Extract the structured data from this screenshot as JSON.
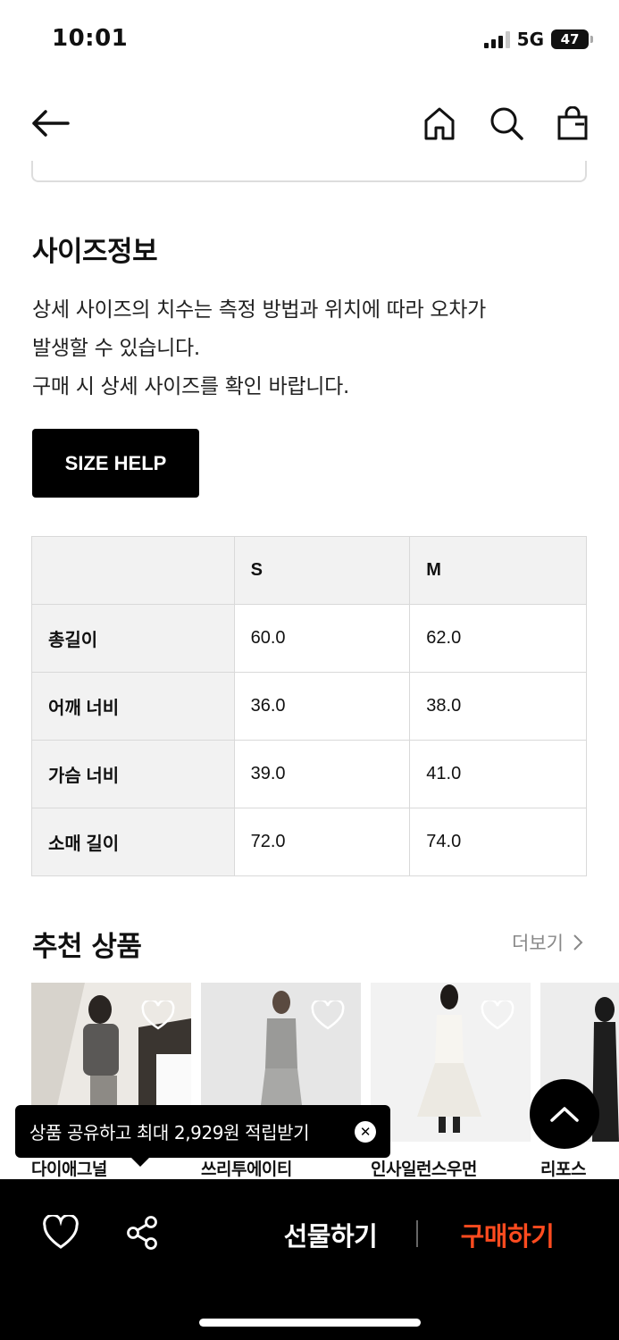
{
  "status_bar": {
    "time": "10:01",
    "network": "5G",
    "battery": "47"
  },
  "nav": {
    "back_icon": "arrow-left-icon",
    "home_icon": "home-icon",
    "search_icon": "search-icon",
    "bag_icon": "shopping-bag-icon"
  },
  "size_info": {
    "title": "사이즈정보",
    "desc_lines": [
      "상세 사이즈의 치수는 측정 방법과 위치에 따라 오차가",
      "발생할 수 있습니다.",
      "구매 시 상세 사이즈를 확인 바랍니다."
    ],
    "size_help_label": "SIZE HELP"
  },
  "size_table": {
    "headers": [
      "",
      "S",
      "M"
    ],
    "rows": [
      {
        "label": "총길이",
        "values": [
          "60.0",
          "62.0"
        ]
      },
      {
        "label": "어깨 너비",
        "values": [
          "36.0",
          "38.0"
        ]
      },
      {
        "label": "가슴 너비",
        "values": [
          "39.0",
          "41.0"
        ]
      },
      {
        "label": "소매 길이",
        "values": [
          "72.0",
          "74.0"
        ]
      }
    ]
  },
  "recommended": {
    "title": "추천 상품",
    "more_label": "더보기",
    "products": [
      {
        "name": "다이애그널"
      },
      {
        "name": "쓰리투에이티"
      },
      {
        "name": "인사일런스우먼"
      },
      {
        "name": "리포스"
      }
    ]
  },
  "tooltip": {
    "text": "상품 공유하고 최대 2,929원 적립받기",
    "close": "✕"
  },
  "bottom_bar": {
    "gift_label": "선물하기",
    "buy_label": "구매하기",
    "accent_color": "#ff4b1f"
  }
}
